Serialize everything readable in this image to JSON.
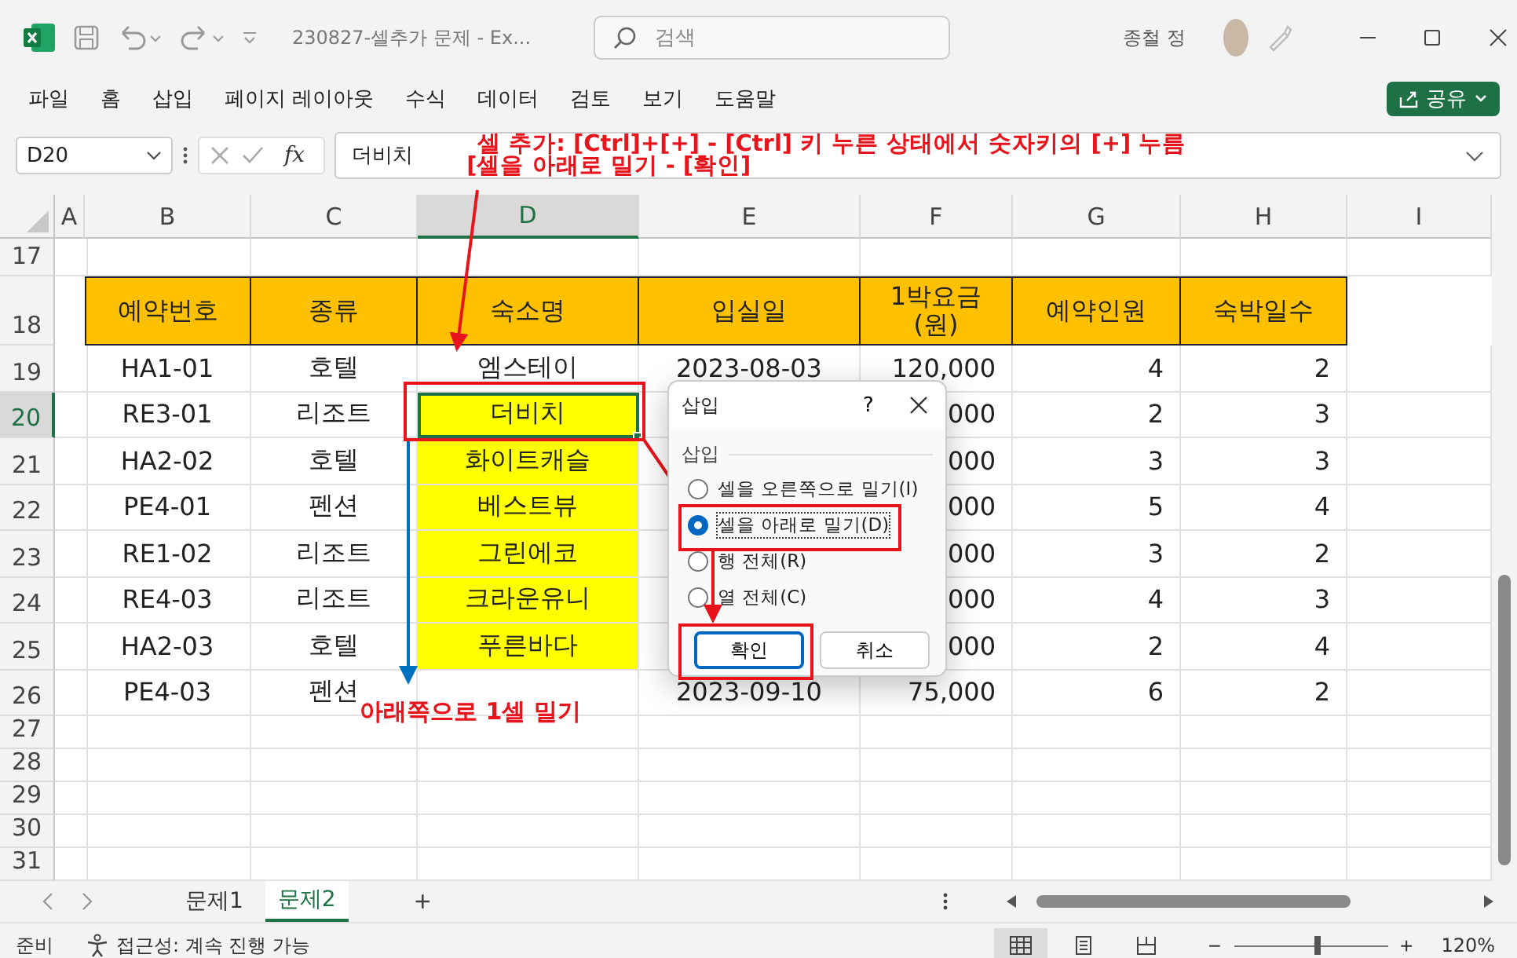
{
  "window": {
    "title": "230827-셀추가 문제  -  Ex...",
    "search_placeholder": "검색",
    "user": "종철 정"
  },
  "menu": [
    "파일",
    "홈",
    "삽입",
    "페이지 레이아웃",
    "수식",
    "데이터",
    "검토",
    "보기",
    "도움말"
  ],
  "share_button": "공유",
  "formula_bar": {
    "name_box": "D20",
    "fx": "fx",
    "value": "더비치"
  },
  "columns": [
    {
      "letter": "A",
      "selected": false
    },
    {
      "letter": "B",
      "selected": false
    },
    {
      "letter": "C",
      "selected": false
    },
    {
      "letter": "D",
      "selected": true
    },
    {
      "letter": "E",
      "selected": false
    },
    {
      "letter": "F",
      "selected": false
    },
    {
      "letter": "G",
      "selected": false
    },
    {
      "letter": "H",
      "selected": false
    },
    {
      "letter": "I",
      "selected": false
    }
  ],
  "rows": [
    {
      "number": "17",
      "kind": "blank",
      "selected": false
    },
    {
      "number": "18",
      "kind": "header",
      "selected": false,
      "cells": {
        "B": {
          "text": "예약번호"
        },
        "C": {
          "text": "종류"
        },
        "D": {
          "text": "숙소명"
        },
        "E": {
          "text": "입실일"
        },
        "F": {
          "text": "1박요금\n(원)"
        },
        "G": {
          "text": "예약인원"
        },
        "H": {
          "text": "숙박일수"
        }
      }
    },
    {
      "number": "19",
      "kind": "data",
      "selected": false,
      "cells": {
        "B": {
          "text": "HA1-01",
          "highlighted": false
        },
        "C": {
          "text": "호텔",
          "highlighted": false
        },
        "D": {
          "text": "엠스테이",
          "highlighted": false
        },
        "E": {
          "text": "2023-08-03",
          "highlighted": false
        },
        "F": {
          "text": "120,000",
          "highlighted": false
        },
        "G": {
          "text": "4",
          "highlighted": false
        },
        "H": {
          "text": "2",
          "highlighted": false
        }
      }
    },
    {
      "number": "20",
      "kind": "data",
      "selected": true,
      "cells": {
        "B": {
          "text": "RE3-01",
          "highlighted": false
        },
        "C": {
          "text": "리조트",
          "highlighted": false
        },
        "D": {
          "text": "더비치",
          "highlighted": true
        },
        "F": {
          "text": "000",
          "highlighted": false
        },
        "G": {
          "text": "2",
          "highlighted": false
        },
        "H": {
          "text": "3",
          "highlighted": false
        }
      }
    },
    {
      "number": "21",
      "kind": "data",
      "selected": false,
      "cells": {
        "B": {
          "text": "HA2-02",
          "highlighted": false
        },
        "C": {
          "text": "호텔",
          "highlighted": false
        },
        "D": {
          "text": "화이트캐슬",
          "highlighted": true
        },
        "F": {
          "text": "000",
          "highlighted": false
        },
        "G": {
          "text": "3",
          "highlighted": false
        },
        "H": {
          "text": "3",
          "highlighted": false
        }
      }
    },
    {
      "number": "22",
      "kind": "data",
      "selected": false,
      "cells": {
        "B": {
          "text": "PE4-01",
          "highlighted": false
        },
        "C": {
          "text": "펜션",
          "highlighted": false
        },
        "D": {
          "text": "베스트뷰",
          "highlighted": true
        },
        "F": {
          "text": "000",
          "highlighted": false
        },
        "G": {
          "text": "5",
          "highlighted": false
        },
        "H": {
          "text": "4",
          "highlighted": false
        }
      }
    },
    {
      "number": "23",
      "kind": "data",
      "selected": false,
      "cells": {
        "B": {
          "text": "RE1-02",
          "highlighted": false
        },
        "C": {
          "text": "리조트",
          "highlighted": false
        },
        "D": {
          "text": "그린에코",
          "highlighted": true
        },
        "F": {
          "text": "000",
          "highlighted": false
        },
        "G": {
          "text": "3",
          "highlighted": false
        },
        "H": {
          "text": "2",
          "highlighted": false
        }
      }
    },
    {
      "number": "24",
      "kind": "data",
      "selected": false,
      "cells": {
        "B": {
          "text": "RE4-03",
          "highlighted": false
        },
        "C": {
          "text": "리조트",
          "highlighted": false
        },
        "D": {
          "text": "크라운유니",
          "highlighted": true
        },
        "F": {
          "text": "000",
          "highlighted": false
        },
        "G": {
          "text": "4",
          "highlighted": false
        },
        "H": {
          "text": "3",
          "highlighted": false
        }
      }
    },
    {
      "number": "25",
      "kind": "data",
      "selected": false,
      "cells": {
        "B": {
          "text": "HA2-03",
          "highlighted": false
        },
        "C": {
          "text": "호텔",
          "highlighted": false
        },
        "D": {
          "text": "푸른바다",
          "highlighted": true
        },
        "F": {
          "text": "000",
          "highlighted": false
        },
        "G": {
          "text": "2",
          "highlighted": false
        },
        "H": {
          "text": "4",
          "highlighted": false
        }
      }
    },
    {
      "number": "26",
      "kind": "data",
      "selected": false,
      "cells": {
        "B": {
          "text": "PE4-03",
          "highlighted": false
        },
        "C": {
          "text": "펜션",
          "highlighted": false
        },
        "E": {
          "text": "2023-09-10",
          "highlighted": false
        },
        "F": {
          "text": "75,000",
          "highlighted": false
        },
        "G": {
          "text": "6",
          "highlighted": false
        },
        "H": {
          "text": "2",
          "highlighted": false
        }
      }
    },
    {
      "number": "27",
      "kind": "blank",
      "selected": false
    },
    {
      "number": "28",
      "kind": "blank",
      "selected": false
    },
    {
      "number": "29",
      "kind": "blank",
      "selected": false
    },
    {
      "number": "30",
      "kind": "blank",
      "selected": false
    },
    {
      "number": "31",
      "kind": "blank",
      "selected": false
    }
  ],
  "dialog": {
    "title": "삽입",
    "help": "?",
    "group_label": "삽입",
    "options": [
      {
        "label": "셀을 오른쪽으로 밀기(I)",
        "selected": false
      },
      {
        "label": "셀을 아래로 밀기(D)",
        "selected": true
      },
      {
        "label": "행 전체(R)",
        "selected": false
      },
      {
        "label": "열 전체(C)",
        "selected": false
      }
    ],
    "buttons": [
      {
        "label": "확인",
        "default": true
      },
      {
        "label": "취소",
        "default": false
      }
    ]
  },
  "annotations": {
    "notes": [
      "셀 추가: [Ctrl]+[+] - [Ctrl] 키 누른 상태에서 숫자키의 [+] 누름",
      "[셀을 아래로 밀기 - [확인]"
    ],
    "push_label": "아래쪽으로 1셀 밀기"
  },
  "sheet_tabs": [
    {
      "label": "문제1",
      "selected": false
    },
    {
      "label": "문제2",
      "selected": true
    }
  ],
  "add_sheet": "+",
  "status_bar": {
    "ready": "준비",
    "accessibility": "접근성: 계속 진행 가능",
    "views": [
      {
        "kind": "normal",
        "selected": true
      },
      {
        "kind": "page-layout",
        "selected": false
      },
      {
        "kind": "page-break",
        "selected": false
      }
    ],
    "zoom_out": "−",
    "zoom_in": "+",
    "zoom": {
      "level": 0.55
    },
    "zoom_text": "120%"
  }
}
